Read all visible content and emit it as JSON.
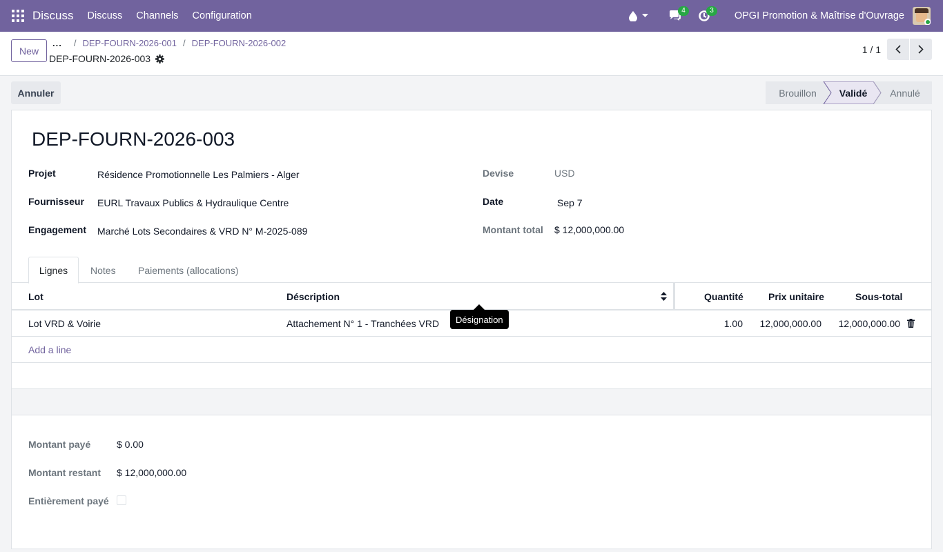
{
  "navbar": {
    "app_name": "Discuss",
    "menu": [
      "Discuss",
      "Channels",
      "Configuration"
    ],
    "messages_badge": "4",
    "activities_badge": "3",
    "company": "OPGI Promotion & Maîtrise d'Ouvrage"
  },
  "control_panel": {
    "new_label": "New",
    "breadcrumb": {
      "dots": "...",
      "sep": "/",
      "items": [
        "DEP-FOURN-2026-001",
        "DEP-FOURN-2026-002"
      ]
    },
    "record_name": "DEP-FOURN-2026-003",
    "pager_value": "1 / 1"
  },
  "statusbar": {
    "cancel_label": "Annuler",
    "steps": [
      "Brouillon",
      "Validé",
      "Annulé"
    ],
    "active": "Validé"
  },
  "form": {
    "title": "DEP-FOURN-2026-003",
    "fields": {
      "projet_label": "Projet",
      "projet_value": "Résidence Promotionnelle Les Palmiers - Alger",
      "fournisseur_label": "Fournisseur",
      "fournisseur_value": "EURL Travaux Publics & Hydraulique Centre",
      "engagement_label": "Engagement",
      "engagement_value": "Marché Lots Secondaires & VRD N° M-2025-089",
      "devise_label": "Devise",
      "devise_value": "USD",
      "date_label": "Date",
      "date_value": "Sep 7",
      "montant_total_label": "Montant total",
      "montant_total_value": "$ 12,000,000.00"
    },
    "tabs": [
      "Lignes",
      "Notes",
      "Paiements (allocations)"
    ],
    "table": {
      "headers": [
        "Lot",
        "Déscription",
        "Quantité",
        "Prix unitaire",
        "Sous-total"
      ],
      "rows": [
        {
          "lot": "Lot VRD & Voirie",
          "description": "Attachement N° 1 - Tranchées VRD",
          "quantite": "1.00",
          "prix": "12,000,000.00",
          "sous_total": "12,000,000.00"
        }
      ],
      "add_line": "Add a line"
    },
    "tooltip": "Désignation",
    "footer": {
      "paye_label": "Montant payé",
      "paye_value": "$ 0.00",
      "restant_label": "Montant restant",
      "restant_value": "$ 12,000,000.00",
      "entierement_label": "Entièrement payé",
      "entierement_value": false
    }
  },
  "colors": {
    "brand": "#71639e",
    "badge": "#28a745",
    "status_active_bg": "#e9e6f2"
  }
}
